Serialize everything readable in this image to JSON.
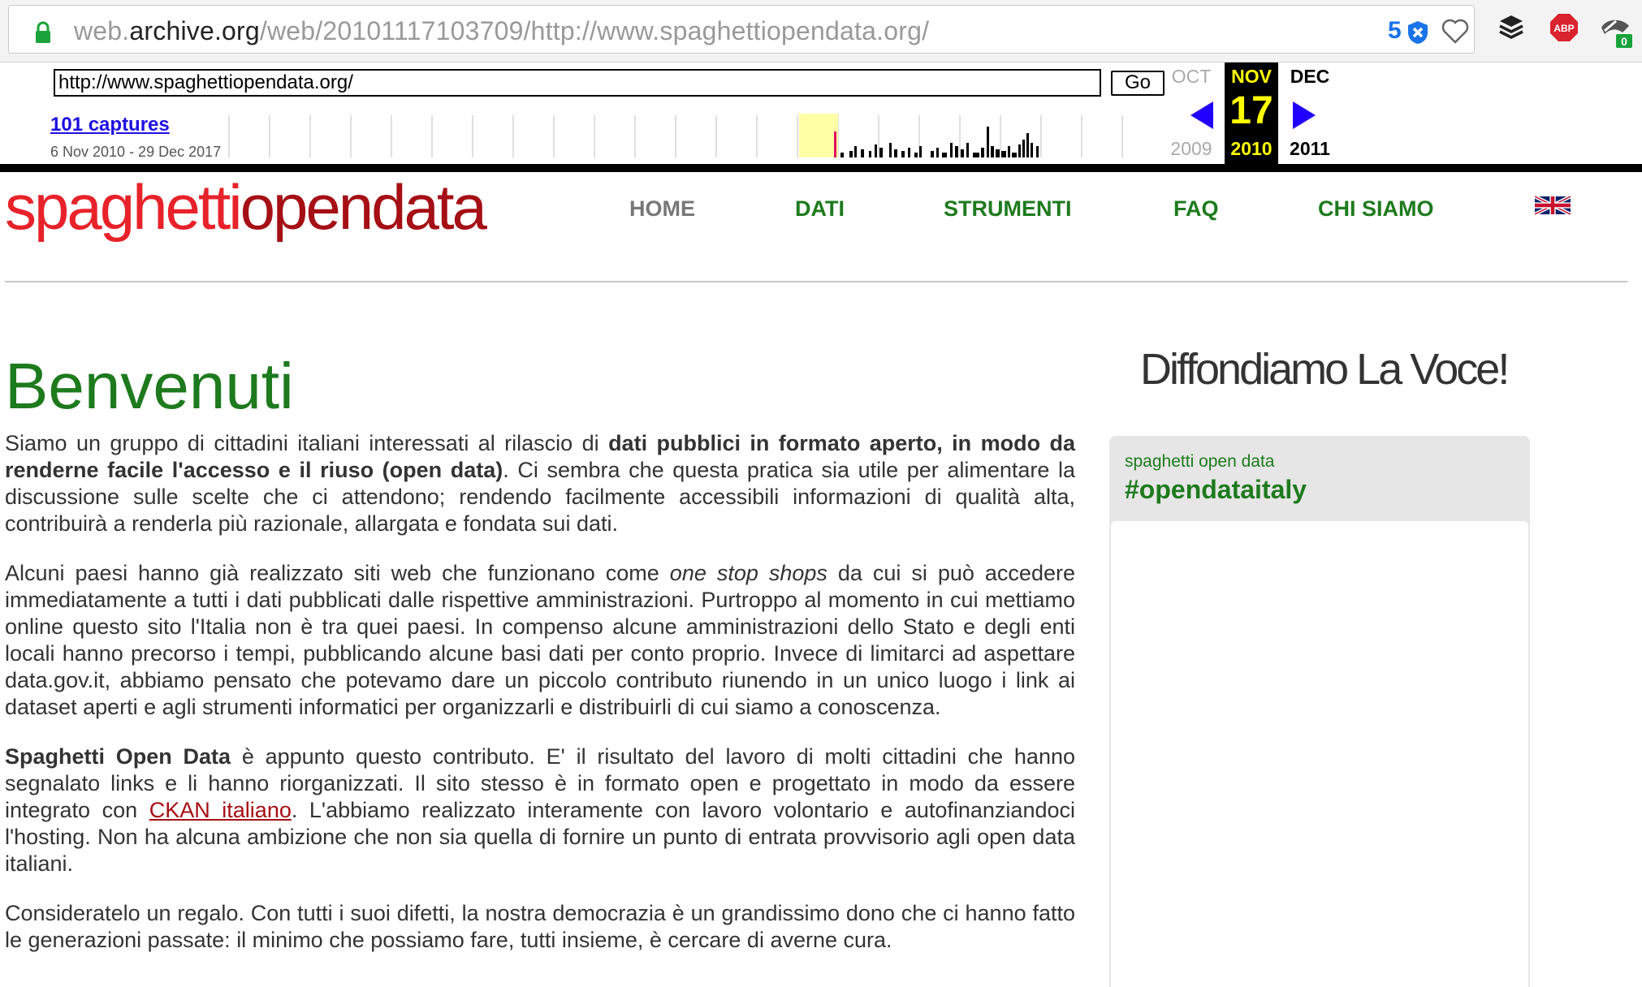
{
  "browser": {
    "url_prefix": "web.",
    "url_domain": "archive.org",
    "url_path": "/web/20101117103709/http://www.spaghettiopendata.org/",
    "ext_count": "5",
    "abp_label": "ABP",
    "ext_badge": "0"
  },
  "wayback": {
    "url_value": "http://www.spaghettiopendata.org/",
    "go_label": "Go",
    "captures": "101 captures",
    "range": "6 Nov 2010 - 29 Dec 2017",
    "prev_month": "OCT",
    "cur_month": "NOV",
    "next_month": "DEC",
    "cur_day": "17",
    "prev_year": "2009",
    "cur_year": "2010",
    "next_year": "2011",
    "colors": {
      "highlight": "#ffffa5",
      "current": "#000000",
      "accent": "#ffff00",
      "arrow": "#2200ff"
    }
  },
  "site": {
    "logo_a": "spaghetti",
    "logo_b": "opendata",
    "nav": {
      "home": "HOME",
      "dati": "DATI",
      "strumenti": "STRUMENTI",
      "faq": "FAQ",
      "chi": "CHI SIAMO"
    },
    "flag": "uk-flag-icon",
    "title": "Benvenuti",
    "p1_a": "Siamo un gruppo di cittadini italiani interessati al rilascio di ",
    "p1_b": "dati pubblici in formato aperto, in modo da renderne facile l'accesso e il riuso (open data)",
    "p1_c": ". Ci sembra che questa pratica sia utile per alimentare la discussione sulle scelte che ci attendono; rendendo facilmente accessibili informazioni di qualità alta, contribuirà a renderla più razionale, allargata e fondata sui dati.",
    "p2_a": "Alcuni paesi hanno già realizzato siti web che funzionano come ",
    "p2_b": "one stop shops",
    "p2_c": " da cui si può accedere immediatamente a tutti i dati pubblicati dalle rispettive amministrazioni. Purtroppo al momento in cui mettiamo online questo sito l'Italia non è tra quei paesi. In compenso alcune amministrazioni dello Stato e degli enti locali hanno precorso i tempi, pubblicando alcune basi dati per conto proprio. Invece di limitarci ad aspettare data.gov.it, abbiamo pensato che potevamo dare un piccolo contributo riunendo in un unico luogo i link ai dataset aperti e agli strumenti informatici per organizzarli e distribuirli di cui siamo a conoscenza.",
    "p3_a": "Spaghetti Open Data",
    "p3_b": " è appunto questo contributo. E' il risultato del lavoro di molti cittadini che hanno segnalato links e li hanno riorganizzati. Il sito stesso è in formato open e progettato in modo da essere integrato con ",
    "p3_link": "CKAN italiano",
    "p3_c": ". L'abbiamo realizzato interamente con lavoro volontario e autofinanziandoci l'hosting. Non ha alcuna ambizione che non sia quella di fornire un punto di entrata provvisorio agli open data italiani.",
    "p4": "Consideratelo un regalo. Con tutti i suoi difetti, la nostra democrazia è un grandissimo dono che ci hanno fatto le generazioni passate: il minimo che possiamo fare, tutti insieme, è cercare di averne cura.",
    "side_title": "Diffondiamo La Voce!",
    "widget_sub": "spaghetti open data",
    "widget_tag": "#opendataitaly",
    "colors": {
      "logo_a": "#e8222a",
      "logo_b": "#a50f15",
      "green": "#1d7a1d"
    }
  }
}
